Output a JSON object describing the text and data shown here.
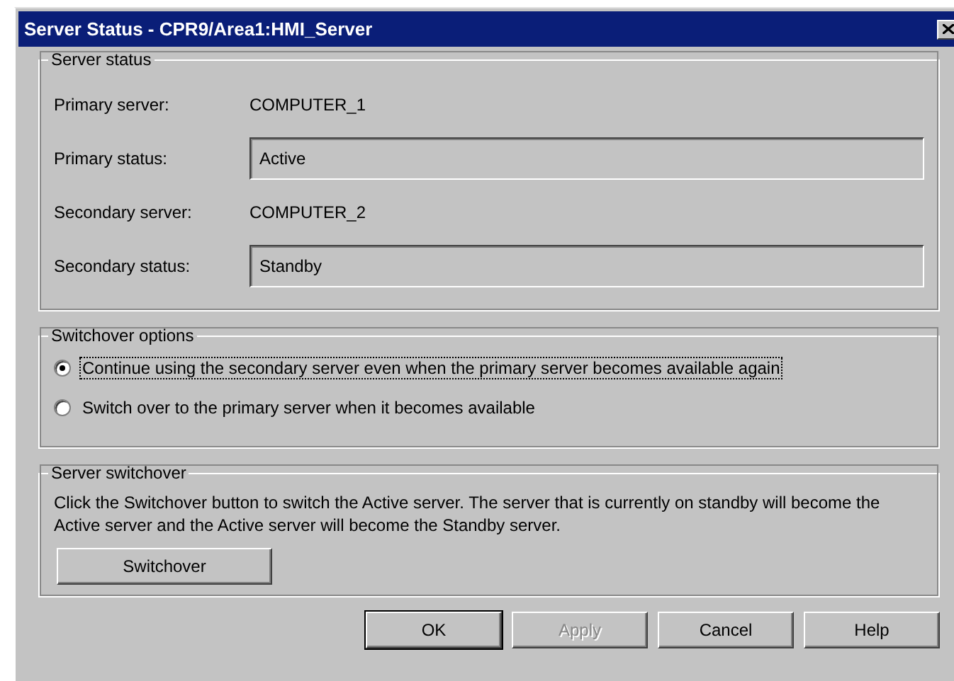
{
  "window": {
    "title": "Server Status - CPR9/Area1:HMI_Server"
  },
  "server_status": {
    "title": "Server status",
    "rows": [
      {
        "kind": "text",
        "label": "Primary server:",
        "value": "COMPUTER_1"
      },
      {
        "kind": "field",
        "label": "Primary status:",
        "value": "Active"
      },
      {
        "kind": "text",
        "label": "Secondary server:",
        "value": "COMPUTER_2"
      },
      {
        "kind": "field",
        "label": "Secondary status:",
        "value": "Standby"
      }
    ]
  },
  "switchover_options": {
    "title": "Switchover options",
    "options": [
      {
        "label": "Continue using the secondary server even when the primary server becomes available again",
        "selected": true,
        "focused": true
      },
      {
        "label": "Switch over to the primary server when it becomes available",
        "selected": false,
        "focused": false
      }
    ]
  },
  "server_switchover": {
    "title": "Server switchover",
    "description": "Click the Switchover button to switch the Active server.  The server that is currently on standby will become the Active server and the Active server will become the Standby server.",
    "button": {
      "label": "Switchover"
    }
  },
  "buttons": [
    {
      "label": "OK",
      "default": true,
      "disabled": false
    },
    {
      "label": "Apply",
      "default": false,
      "disabled": true
    },
    {
      "label": "Cancel",
      "default": false,
      "disabled": false
    },
    {
      "label": "Help",
      "default": false,
      "disabled": false
    }
  ]
}
